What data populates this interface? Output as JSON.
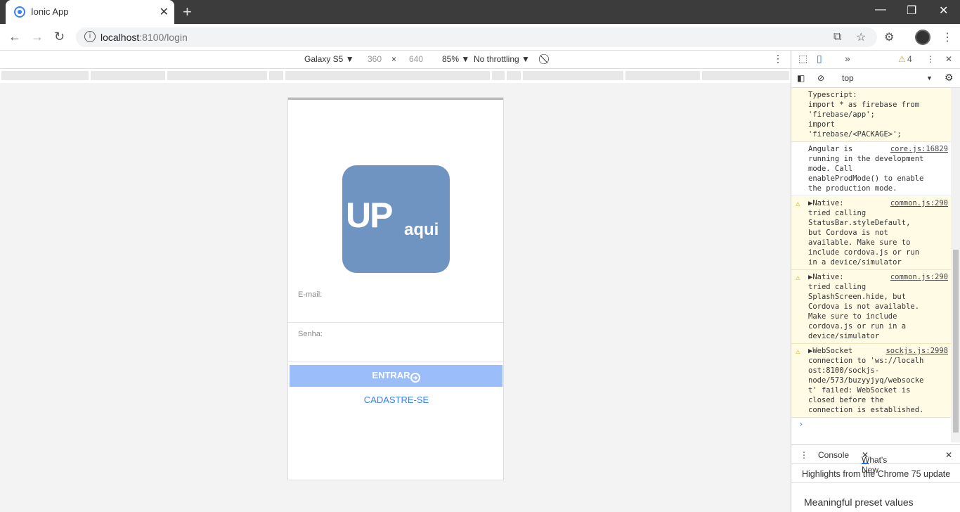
{
  "browser": {
    "tab_title": "Ionic App",
    "url_host": "localhost",
    "url_path": ":8100/login"
  },
  "device_toolbar": {
    "device": "Galaxy S5 ▼",
    "width": "360",
    "times": "×",
    "height": "640",
    "zoom": "85% ▼",
    "throttling": "No throttling ▼"
  },
  "app": {
    "logo_main": "UP",
    "logo_sub": "aqui",
    "email_label": "E-mail:",
    "email_value": "",
    "password_label": "Senha:",
    "password_value": "",
    "login_button": "ENTRAR",
    "register_link": "CADASTRE-SE",
    "accent_color": "#3880ff",
    "logo_color": "#7094c1"
  },
  "devtools": {
    "warnings_count": "4",
    "context": "top",
    "messages": [
      {
        "type": "warn-cont",
        "text": "Typescript:\nimport * as firebase from\n'firebase/app';\nimport\n'firebase/<PACKAGE>';",
        "source": ""
      },
      {
        "type": "info",
        "text": "Angular is\nrunning in the development\nmode. Call\nenableProdMode() to enable\nthe production mode.",
        "source": "core.js:16829"
      },
      {
        "type": "warn",
        "text": "▶Native:\ntried calling\nStatusBar.styleDefault,\nbut Cordova is not\navailable. Make sure to\ninclude cordova.js or run\nin a device/simulator",
        "source": "common.js:290"
      },
      {
        "type": "warn",
        "text": "▶Native:\ntried calling\nSplashScreen.hide, but\nCordova is not available.\nMake sure to include\ncordova.js or run in a\ndevice/simulator",
        "source": "common.js:290"
      },
      {
        "type": "warn",
        "text": "▶WebSocket\nconnection to 'ws://localh\nost:8100/sockjs-\nnode/573/buzyyjyq/websocke\nt' failed: WebSocket is\nclosed before the\nconnection is established.",
        "source": "sockjs.js:2998"
      }
    ],
    "drawer_tab_console": "Console",
    "drawer_tab_whatsnew": "What's New",
    "drawer_headline": "Highlights from the Chrome 75 update",
    "drawer_item": "Meaningful preset values"
  }
}
